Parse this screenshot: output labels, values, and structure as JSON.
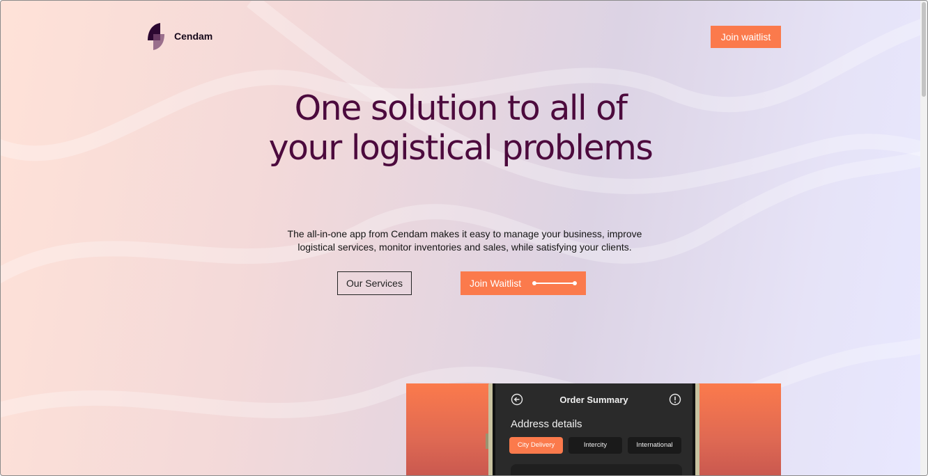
{
  "nav": {
    "brand": "Cendam",
    "cta_label": "Join waitlist"
  },
  "hero": {
    "headline": "One solution to all of your logistical problems",
    "subtitle": "The all-in-one app from Cendam makes it easy to manage your business, improve logistical services, monitor inventories and sales, while satisfying your clients.",
    "secondary_button": "Our Services",
    "primary_button": "Join Waitlist"
  },
  "phone_preview": {
    "title": "Order Summary",
    "section": "Address details",
    "tabs": [
      {
        "label": "City Delivery",
        "active": true
      },
      {
        "label": "Intercity",
        "active": false
      },
      {
        "label": "International",
        "active": false
      }
    ]
  },
  "colors": {
    "accent": "#fb7a4c",
    "headline": "#4c0a3d"
  }
}
